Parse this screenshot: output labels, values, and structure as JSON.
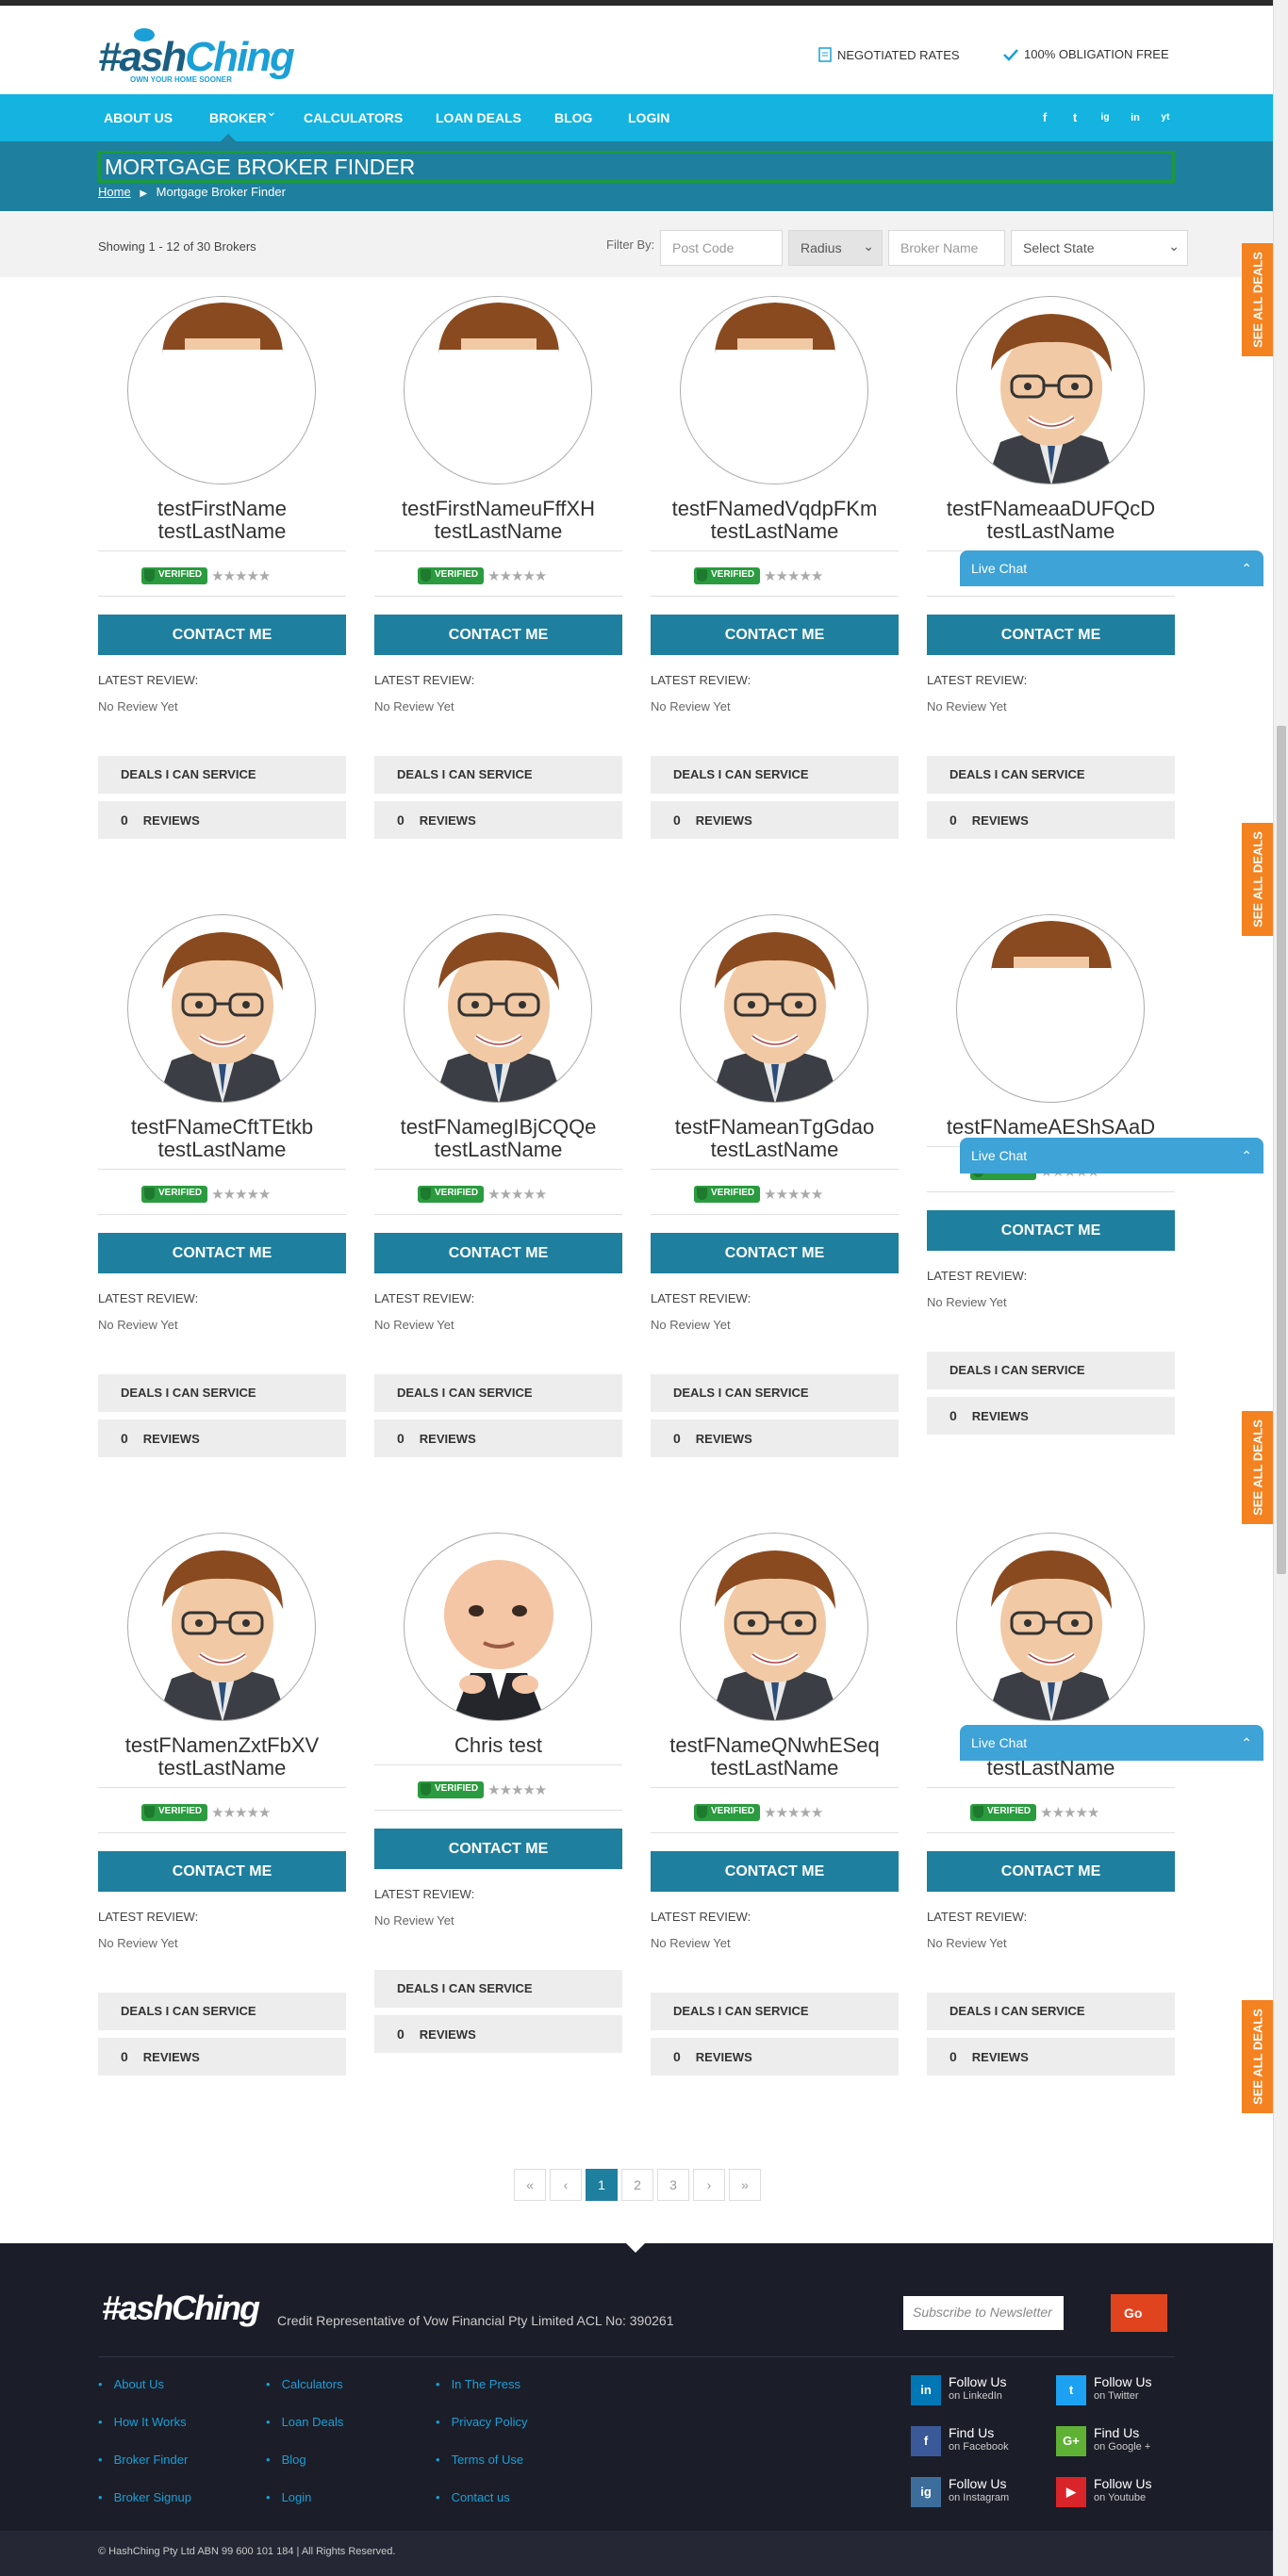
{
  "header": {
    "logo_main": "#ash",
    "logo_accent": "Ching",
    "logo_tagline": "OWN YOUR HOME SOONER",
    "badge_rates": "NEGOTIATED RATES",
    "badge_free": "100% OBLIGATION FREE"
  },
  "nav": {
    "items": [
      "ABOUT US",
      "BROKER",
      "CALCULATORS",
      "LOAN DEALS",
      "BLOG",
      "LOGIN"
    ],
    "broker_caret": "⌄",
    "social": [
      "f",
      "t",
      "ig",
      "in",
      "yt"
    ]
  },
  "banner": {
    "title": "MORTGAGE BROKER FINDER",
    "crumb_home": "Home",
    "crumb_sep": "▶",
    "crumb_current": "Mortgage Broker Finder"
  },
  "filters": {
    "showing": "Showing 1 - 12 of 30 Brokers",
    "filter_by": "Filter By:",
    "postcode_placeholder": "Post Code",
    "radius": "Radius",
    "broker_name_placeholder": "Broker Name",
    "state": "Select State"
  },
  "card_labels": {
    "verified": "VERIFIED",
    "stars": "★★★★★",
    "contact": "CONTACT ME",
    "latest_review": "LATEST REVIEW:",
    "no_review": "No Review Yet",
    "deals": "DEALS I CAN SERVICE",
    "reviews": "REVIEWS",
    "review_count": "0"
  },
  "brokers": [
    {
      "first": "testFirstName",
      "last": "testLastName",
      "avatar": "partial"
    },
    {
      "first": "testFirstNameuFffXH",
      "last": "testLastName",
      "avatar": "partial"
    },
    {
      "first": "testFNamedVqdpFKm",
      "last": "testLastName",
      "avatar": "partial"
    },
    {
      "first": "testFNameaaDUFQcD",
      "last": "testLastName",
      "avatar": "full"
    },
    {
      "first": "testFNameCftTEtkb",
      "last": "testLastName",
      "avatar": "full"
    },
    {
      "first": "testFNamegIBjCQQe",
      "last": "testLastName",
      "avatar": "full"
    },
    {
      "first": "testFNameanTgGdao",
      "last": "testLastName",
      "avatar": "full"
    },
    {
      "first": "testFNameAEShSAaD",
      "last": "",
      "avatar": "partial"
    },
    {
      "first": "testFNamenZxtFbXV",
      "last": "testLastName",
      "avatar": "full"
    },
    {
      "first": "Chris test",
      "last": "",
      "avatar": "baby"
    },
    {
      "first": "testFNameQNwhESeq",
      "last": "testLastName",
      "avatar": "full"
    },
    {
      "first": "te",
      "last": "testLastName",
      "avatar": "full"
    }
  ],
  "see_all_deals": "SEE ALL DEALS",
  "live_chat": "Live Chat",
  "chat_caret": "⌃",
  "pagination": [
    "«",
    "‹",
    "1",
    "2",
    "3",
    "›",
    "»"
  ],
  "pagination_active": "1",
  "footer": {
    "logo": "#ashChing",
    "credit": "Credit Representative of Vow Financial Pty Limited ACL No: 390261",
    "subscribe_placeholder": "Subscribe to Newsletter",
    "go": "Go",
    "col1": [
      "About Us",
      "How It Works",
      "Broker Finder",
      "Broker Signup"
    ],
    "col2": [
      "Calculators",
      "Loan Deals",
      "Blog",
      "Login"
    ],
    "col3": [
      "In The Press",
      "Privacy Policy",
      "Terms of Use",
      "Contact us"
    ],
    "social": [
      {
        "icon": "in",
        "title": "Follow Us",
        "sub": "on LinkedIn",
        "color": "#0077b5"
      },
      {
        "icon": "t",
        "title": "Follow Us",
        "sub": "on Twitter",
        "color": "#1da1f2"
      },
      {
        "icon": "f",
        "title": "Find Us",
        "sub": "on Facebook",
        "color": "#3b5998"
      },
      {
        "icon": "G+",
        "title": "Find Us",
        "sub": "on Google +",
        "color": "#5fb136"
      },
      {
        "icon": "ig",
        "title": "Follow Us",
        "sub": "on Instagram",
        "color": "#3d6e9b"
      },
      {
        "icon": "▶",
        "title": "Follow Us",
        "sub": "on Youtube",
        "color": "#d9252a"
      }
    ],
    "copyright": "© HashChing Pty Ltd   ABN 99 600 101 184   |   All Rights Reserved."
  },
  "colors": {
    "nav": "#14b3e0",
    "banner": "#1f7f9e",
    "contact_button": "#1f7f9e",
    "see_all_deals": "#f58220",
    "live_chat": "#3ea3d6",
    "footer": "#1b1d28",
    "verified": "#2a9b3e"
  }
}
